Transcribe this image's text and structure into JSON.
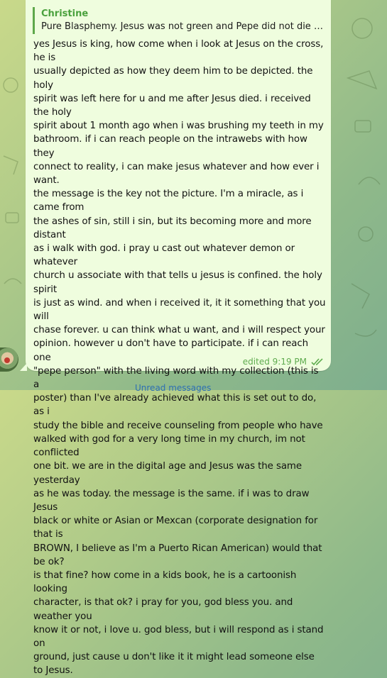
{
  "message": {
    "reply": {
      "author": "Christine",
      "text": "Pure Blasphemy. Jesus was not green and Pepe did not die for th..."
    },
    "body": "yes Jesus is king, how come when i look at Jesus on the cross, he is\nusually depicted as how they deem him to be depicted. the holy\nspirit was left here for u and me after Jesus died. i received the holy\nspirit about 1 month ago when i was brushing my teeth in my\nbathroom. if i can reach people on the intrawebs with how they\nconnect to reality, i can make jesus whatever and how ever i want.\nthe message is the key not the picture. I'm a miracle, as i came from\nthe ashes of sin, still i sin, but its becoming more and more distant\nas i walk with god. i pray u cast out whatever demon or whatever\nchurch u associate with that tells u jesus is confined. the holy spirit\nis just as wind. and when i received it, it it something that you will\nchase forever. u can think what u want, and i will respect your\nopinion.  however u don't have to participate. if i can reach one\n\"pepe person\" with the living word with my collection (this is a\nposter) than I've already achieved what this is set out to do, as i\nstudy the bible and receive counseling from people who have\nwalked with god for a very long time in my church, im not conflicted\none bit. we are in the digital age and Jesus was the same yesterday\nas he was today. the message is the same. if i was to draw Jesus\nblack or white or Asian or Mexcan (corporate designation for that is\nBROWN, I believe as I'm a Puerto Rican American) would that be ok?\nis that fine? how come in a kids book, he is a cartoonish looking\ncharacter, is that ok? i pray for you, god bless you. and weather you\nknow it or not, i love u. god bless, but i will respond as i stand on\nground, just cause u don't like it it might lead someone else to Jesus.",
    "status": "edited 9:19 PM",
    "read_icon": "double-check-icon",
    "colors": {
      "bubble": "#effdde",
      "accent": "#4aa13d",
      "meta": "#5fab4f"
    }
  },
  "footer": {
    "unread_label": "Unread messages"
  }
}
